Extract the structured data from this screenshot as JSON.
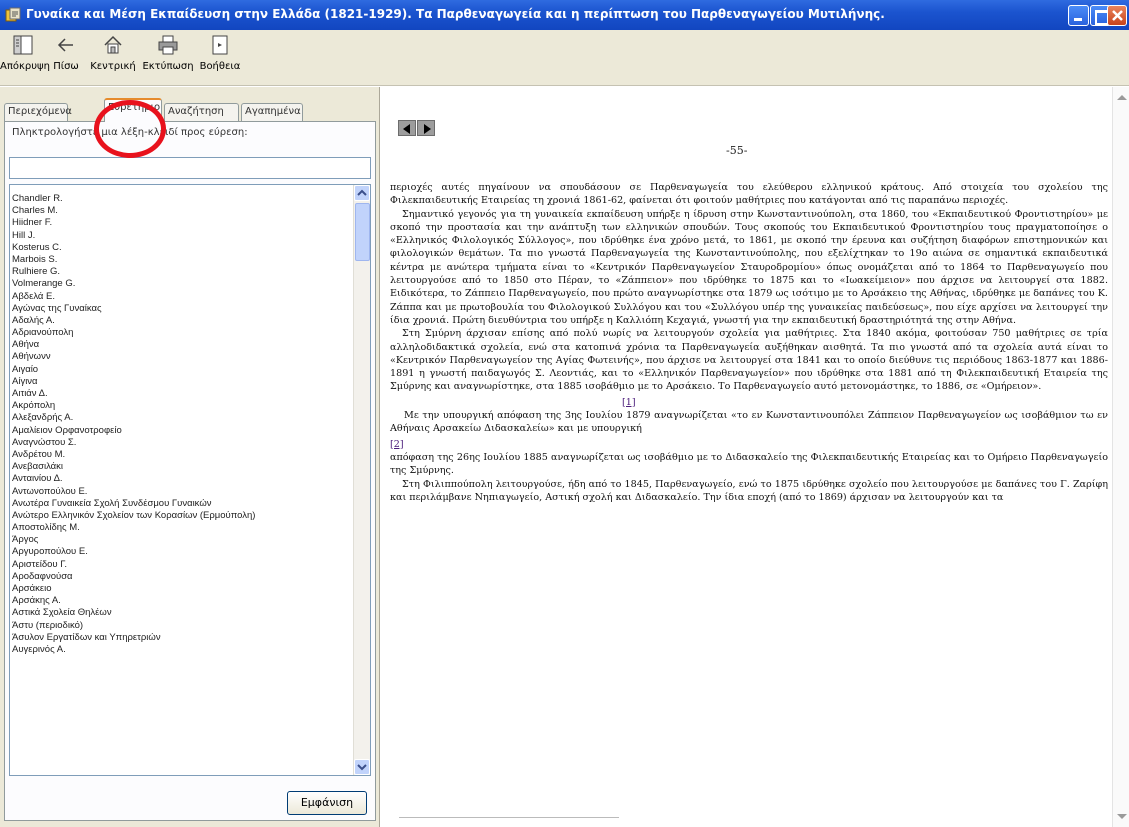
{
  "window": {
    "title": "Γυναίκα και Μέση Εκπαίδευση στην Ελλάδα (1821-1929). Τα Παρθεναγωγεία και η περίπτωση του Παρθεναγωγείου Μυτιλήνης."
  },
  "toolbar": {
    "buttons": [
      {
        "label": "Απόκρυψη",
        "icon": "hide-pane-icon"
      },
      {
        "label": "Πίσω",
        "icon": "back-arrow-icon"
      },
      {
        "label": "Κεντρική",
        "icon": "home-icon"
      },
      {
        "label": "Εκτύπωση",
        "icon": "printer-icon"
      },
      {
        "label": "Βοήθεια",
        "icon": "help-icon"
      }
    ]
  },
  "tabs": [
    "Περιεχόμενα",
    "Ευρετήριο",
    "Αναζήτηση",
    "Αγαπημένα"
  ],
  "active_tab": "Ευρετήριο",
  "index": {
    "prompt": "Πληκτρολογήστε μια λέξη-κλειδί προς εύρεση:",
    "input_value": "",
    "items": [
      "Chandler R.",
      "Charles M.",
      "Hiidner F.",
      "Hill J.",
      "Kosterus C.",
      "Marbois S.",
      "Rulhiere G.",
      "Volmerange G.",
      "Αβδελά Ε.",
      "Αγώνας της Γυναίκας",
      "Αδαλής Α.",
      "Αδριανούπολη",
      "Αθήνα",
      "Αθήνωνν",
      "Αιγαίο",
      "Αίγινα",
      "Αιτιάν Δ.",
      "Ακρόπολη",
      "Αλεξανδρής Α.",
      "Αμαλίειον Ορφανοτροφείο",
      "Αναγνώστου Σ.",
      "Ανδρέτου Μ.",
      "Ανεβασιλάκι",
      "Ανταινίου Δ.",
      "Αντωνοπούλου Ε.",
      "Ανωτέρα Γυναικεία Σχολή Συνδέσμου Γυναικών",
      "Ανώτερο Ελληνικόν Σχολείον των Κορασίων (Ερμούπολη)",
      "Αποστολίδης Μ.",
      "Άργος",
      "Αργυροπούλου Ε.",
      "Αριστείδου Γ.",
      "Αροδαφνούσα",
      "Αρσάκειο",
      "Αρσάκης Α.",
      "Αστικά Σχολεία Θηλέων",
      "Άστυ (περιοδικό)",
      "Άσυλον Εργατίδων και Υπηρετριών",
      "Αυγερινός Α."
    ],
    "show_button": "Εμφάνιση"
  },
  "content": {
    "page_number": "-55-",
    "paragraphs": [
      "περιοχές αυτές πηγαίνουν να σπουδάσουν σε Παρθεναγωγεία του ελεύθερου ελληνικού κράτους. Από στοιχεία του σχολείου της Φιλεκπαιδευτικής Εταιρείας τη χρονιά 1861-62, φαίνεται ότι φοιτούν μαθήτριες που κατάγονται από τις παραπάνω περιοχές.",
      "Σημαντικό γεγονός για τη γυναικεία εκπαίδευση υπήρξε η ίδρυση στην Κωνσταντινούπολη, στα 1860, του «Εκπαιδευτικού Φροντιστηρίου» με σκοπό την προστασία και την ανάπτυξη των ελληνικών σπουδών. Τους σκοπούς του Εκπαιδευτικού Φροντιστηρίου τους πραγματοποίησε ο «Ελληνικός Φιλολογικός Σύλλογος», που ιδρύθηκε ένα χρόνο μετά, το 1861, με σκοπό την έρευνα και συζήτηση διαφόρων επιστημονικών και φιλολογικών θεμάτων. Τα πιο γνωστά Παρθεναγωγεία της Κωνσταντινούπολης, που εξελίχτηκαν το 19ο αιώνα σε σημαντικά εκπαιδευτικά κέντρα με ανώτερα τμήματα είναι το «Κεντρικόν Παρθεναγωγείον Σταυροδρομίου» όπως ονομάζεται από το 1864 το Παρθεναγωγείο που λειτουργούσε από το 1850 στο Πέραν, το «Ζάππειον» που ιδρύθηκε το 1875 και το «Ιωακείμειον» που άρχισε να λειτουργεί στα 1882. Ειδικότερα, το Ζάππειο Παρθεναγωγείο, που πρώτο αναγνωρίστηκε στα 1879 ως ισότιμο με το Αρσάκειο της Αθήνας, ιδρύθηκε με δαπάνες του Κ. Ζάππα και με πρωτοβουλία του Φιλολογικού Συλλόγου και του «Συλλόγου υπέρ της γυναικείας παιδεύσεως», που είχε αρχίσει να λειτουργεί την ίδια χρονιά. Πρώτη διευθύντρια του υπήρξε η Καλλιόπη Κεχαγιά, γνωστή για την εκπαιδευτική δραστηριότητά της στην Αθήνα.",
      "Στη Σμύρνη άρχισαν επίσης από πολύ νωρίς να λειτουργούν σχολεία για μαθήτριες. Στα 1840 ακόμα, φοιτούσαν 750 μαθήτριες σε τρία αλληλοδιδακτικά σχολεία, ενώ στα κατοπινά χρόνια τα Παρθεναγωγεία αυξήθηκαν αισθητά. Τα πιο γνωστά από τα σχολεία αυτά είναι το «Κεντρικόν Παρθεναγωγείον της Αγίας Φωτεινής», που άρχισε να λειτουργεί στα 1841 και το οποίο διεύθυνε τις περιόδους 1863-1877 και 1886-1891 η γνωστή παιδαγωγός Σ. Λεοντιάς, και το «Ελληνικόν Παρθεναγωγείον» που ιδρύθηκε στα 1881 από τη Φιλεκπαιδευτική Εταιρεία της Σμύρνης και αναγνωρίστηκε, στα 1885 ισοβάθμιο με το Αρσάκειο. Το Παρθεναγωγείο αυτό μετονομάστηκε, το 1886, σε «Ομήρειον»."
    ],
    "footnote_1": "[1]",
    "para4_a": "Με την υπουργική απόφαση",
    "para4_b": "της 3ης Ιουλίου 1879 αναγνωρίζεται «το εν Κωνσταντινουπόλει Ζάππειον Παρθεναγωγείον ως ισοβάθμιον τω εν Αθήναις Αρσακείω Διδασκαλείω» και με υπουργική",
    "footnote_2": "[2]",
    "para5_a": "απόφαση",
    "para5_b": "της 26ης Ιουλίου 1885 αναγνωρίζεται ως ισοβάθμιο με το Διδασκαλείο της Φιλεκπαιδευτικής Εταιρείας και το Ομήρειο Παρθεναγωγείο της Σμύρνης.",
    "para6": "Στη Φιλιππούπολη λειτουργούσε, ήδη από το 1845, Παρθεναγωγείο, ενώ το 1875 ιδρύθηκε σχολείο που λειτουργούσε με δαπάνες του Γ. Ζαρίφη και περιλάμβανε Νηπιαγωγείο, Αστική σχολή και Διδασκαλείο. Την ίδια εποχή (από το 1869) άρχισαν να λειτουργούν και τα"
  },
  "colors": {
    "titlebar": "#1b54cf",
    "chrome": "#ece9d8",
    "highlight_circle": "#e8121d"
  }
}
